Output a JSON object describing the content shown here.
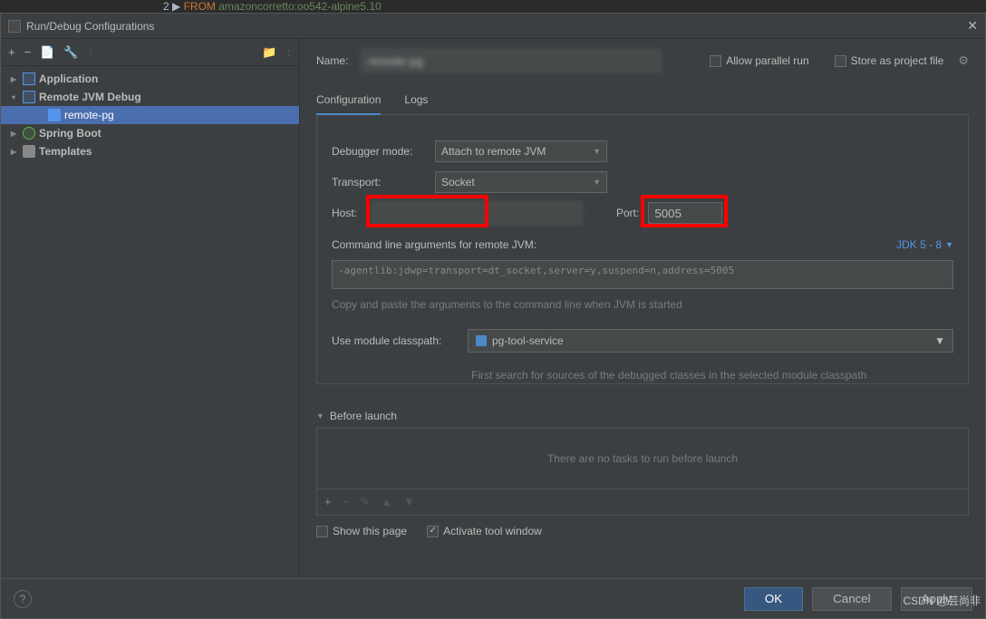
{
  "window": {
    "title": "Run/Debug Configurations"
  },
  "backgroundCode": {
    "keyword": "FROM",
    "value": " amazoncorretto:oo542-alpine5.10"
  },
  "toolbar": {
    "add": "+",
    "remove": "−",
    "copy": "📄",
    "wrench": "🔧",
    "up": "↑",
    "folder": "📁",
    "sort": "↕"
  },
  "tree": {
    "application": {
      "label": "Application"
    },
    "remote": {
      "label": "Remote JVM Debug",
      "child": "remote-pg"
    },
    "spring": {
      "label": "Spring Boot"
    },
    "templates": {
      "label": "Templates"
    }
  },
  "nameRow": {
    "label": "Name:",
    "value": "remote-pg",
    "allowParallel": "Allow parallel run",
    "storeAsProject": "Store as project file"
  },
  "tabs": {
    "configuration": "Configuration",
    "logs": "Logs"
  },
  "form": {
    "debuggerModeLabel": "Debugger mode:",
    "debuggerModeValue": "Attach to remote JVM",
    "transportLabel": "Transport:",
    "transportValue": "Socket",
    "hostLabel": "Host:",
    "hostValue": "",
    "portLabel": "Port:",
    "portValue": "5005",
    "cmdLabel": "Command line arguments for remote JVM:",
    "jdkLabel": "JDK 5 - 8",
    "cmdValue": "-agentlib:jdwp=transport=dt_socket,server=y,suspend=n,address=5005",
    "cmdHint": "Copy and paste the arguments to the command line when JVM is started",
    "moduleLabel": "Use module classpath:",
    "moduleValue": "pg-tool-service",
    "moduleHint": "First search for sources of the debugged classes in the selected module classpath"
  },
  "beforeLaunch": {
    "title": "Before launch",
    "empty": "There are no tasks to run before launch",
    "showThisPage": "Show this page",
    "activateTool": "Activate tool window"
  },
  "footer": {
    "ok": "OK",
    "cancel": "Cancel",
    "apply": "Apply"
  },
  "watermark": "CSDN @芸尚非"
}
